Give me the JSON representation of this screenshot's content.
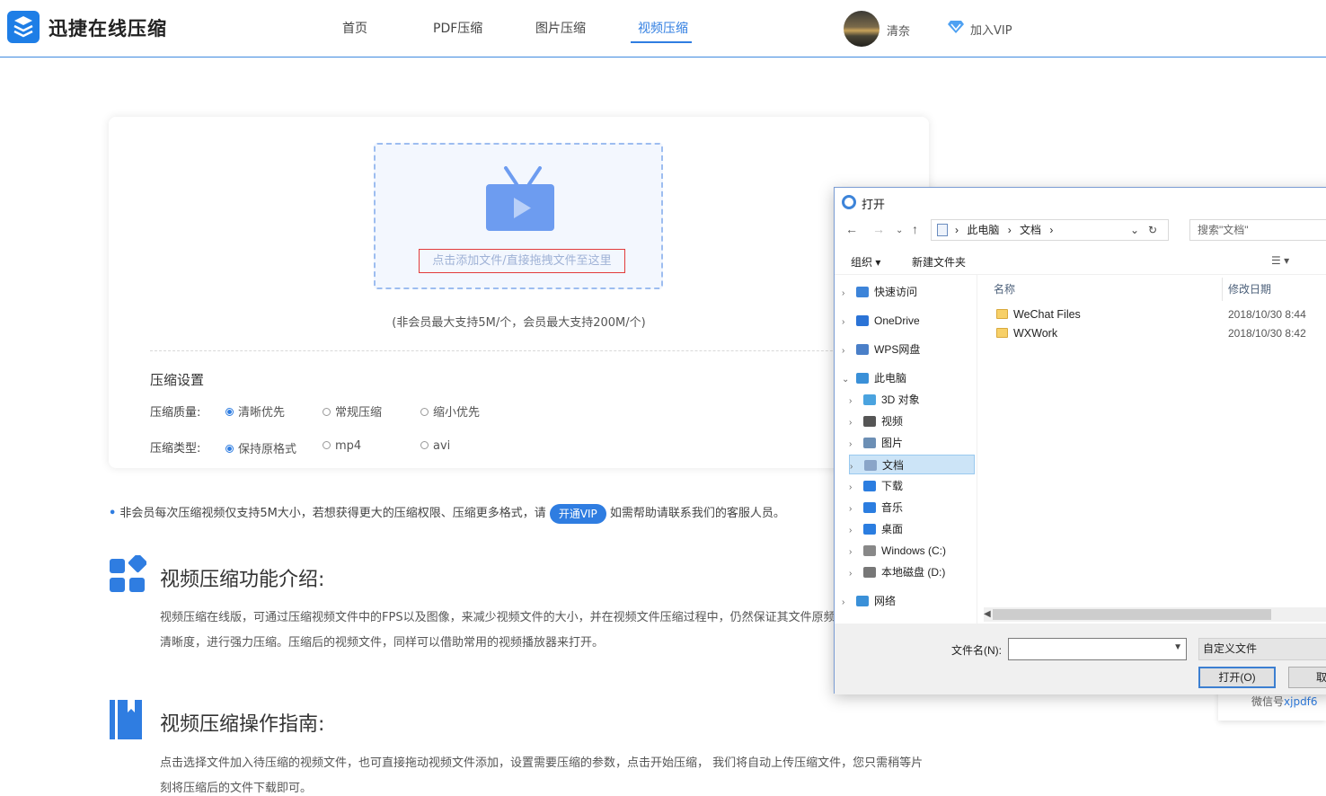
{
  "header": {
    "brand": "迅捷在线压缩",
    "nav": [
      {
        "label": "首页",
        "active": false
      },
      {
        "label": "PDF压缩",
        "active": false
      },
      {
        "label": "图片压缩",
        "active": false
      },
      {
        "label": "视频压缩",
        "active": true
      }
    ],
    "username": "清奈",
    "vip_label": "加入VIP"
  },
  "upload": {
    "drop_text": "点击添加文件/直接拖拽文件至这里",
    "limit_note": "(非会员最大支持5M/个，会员最大支持200M/个)"
  },
  "settings": {
    "title": "压缩设置",
    "quality_label": "压缩质量:",
    "quality_options": [
      "清晰优先",
      "常规压缩",
      "缩小优先"
    ],
    "quality_selected": "清晰优先",
    "type_label": "压缩类型:",
    "type_options": [
      "保持原格式",
      "mp4",
      "avi"
    ],
    "type_selected": "保持原格式"
  },
  "notice": {
    "text_before": "非会员每次压缩视频仅支持5M大小，若想获得更大的压缩权限、压缩更多格式，请",
    "vip_button": "开通VIP",
    "text_after": "如需帮助请联系我们的客服人员。"
  },
  "intro": {
    "title": "视频压缩功能介绍:",
    "body": "视频压缩在线版，可通过压缩视频文件中的FPS以及图像，来减少视频文件的大小，并在视频文件压缩过程中，仍然保证其文件原频清晰度，进行强力压缩。压缩后的视频文件，同样可以借助常用的视频播放器来打开。"
  },
  "guide": {
    "title": "视频压缩操作指南:",
    "body": "点击选择文件加入待压缩的视频文件，也可直接拖动视频文件添加，设置需要压缩的参数，点击开始压缩， 我们将自动上传压缩文件，您只需稍等片刻将压缩后的文件下载即可。"
  },
  "wechat": {
    "label": "微信号",
    "id": "xjpdf6"
  },
  "dialog": {
    "title": "打开",
    "breadcrumb": [
      "此电脑",
      "文档"
    ],
    "search_placeholder": "搜索\"文档\"",
    "toolbar": {
      "organize": "组织 ▾",
      "new_folder": "新建文件夹"
    },
    "tree": [
      {
        "label": "快速访问",
        "icon": "star-icon",
        "color": "#3d84d9",
        "level": 0
      },
      {
        "label": "OneDrive",
        "icon": "cloud-icon",
        "color": "#2b73d6",
        "level": 0
      },
      {
        "label": "WPS网盘",
        "icon": "cloud-outline-icon",
        "color": "#4a7fc8",
        "level": 0
      },
      {
        "label": "此电脑",
        "icon": "computer-icon",
        "color": "#3a90d8",
        "level": 0,
        "expanded": true
      },
      {
        "label": "3D 对象",
        "icon": "cube-icon",
        "color": "#4aa3df",
        "level": 1
      },
      {
        "label": "视频",
        "icon": "film-icon",
        "color": "#555555",
        "level": 1
      },
      {
        "label": "图片",
        "icon": "picture-icon",
        "color": "#6c8fb5",
        "level": 1
      },
      {
        "label": "文档",
        "icon": "document-icon",
        "color": "#8aa5c8",
        "level": 1,
        "selected": true
      },
      {
        "label": "下载",
        "icon": "download-icon",
        "color": "#2b7de0",
        "level": 1
      },
      {
        "label": "音乐",
        "icon": "music-icon",
        "color": "#2b7de0",
        "level": 1
      },
      {
        "label": "桌面",
        "icon": "desktop-icon",
        "color": "#2b7de0",
        "level": 1
      },
      {
        "label": "Windows (C:)",
        "icon": "drive-c-icon",
        "color": "#888888",
        "level": 1
      },
      {
        "label": "本地磁盘 (D:)",
        "icon": "drive-d-icon",
        "color": "#777777",
        "level": 1
      },
      {
        "label": "网络",
        "icon": "network-icon",
        "color": "#3a90d8",
        "level": 0
      }
    ],
    "columns": {
      "name": "名称",
      "modified": "修改日期"
    },
    "files": [
      {
        "name": "WeChat Files",
        "date": "2018/10/30 8:44"
      },
      {
        "name": "WXWork",
        "date": "2018/10/30 8:42"
      }
    ],
    "filename_label": "文件名(N):",
    "filetype": "自定义文件",
    "open_button": "打开(O)",
    "cancel_button": "取消"
  },
  "colors": {
    "accent": "#2f7de1",
    "highlight": "#e23b3b"
  }
}
